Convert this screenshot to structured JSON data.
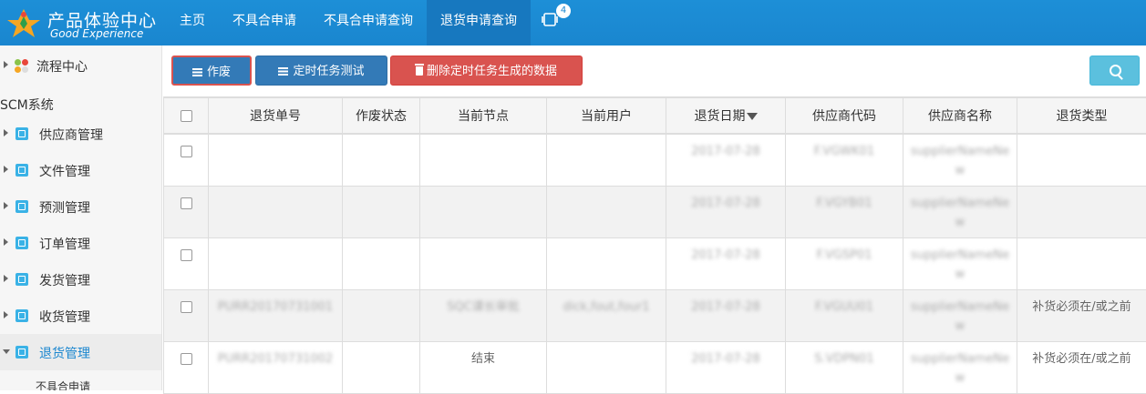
{
  "brand": {
    "title": "产品体验中心",
    "subtitle": "Good Experience"
  },
  "topnav": {
    "items": [
      {
        "label": "主页"
      },
      {
        "label": "不具合申请"
      },
      {
        "label": "不具合申请查询"
      },
      {
        "label": "退货申请查询",
        "active": true
      }
    ],
    "message_badge": "4"
  },
  "sidebar": {
    "flow_center": "流程中心",
    "section": "SCM系统",
    "items": [
      {
        "label": "供应商管理"
      },
      {
        "label": "文件管理"
      },
      {
        "label": "预测管理"
      },
      {
        "label": "订单管理"
      },
      {
        "label": "发货管理"
      },
      {
        "label": "收货管理"
      },
      {
        "label": "退货管理",
        "active": true
      }
    ],
    "sub_item": "不具合申请"
  },
  "toolbar": {
    "void_label": "作废",
    "task_test_label": "定时任务测试",
    "delete_label": "删除定时任务生成的数据"
  },
  "table": {
    "headers": [
      "退货单号",
      "作废状态",
      "当前节点",
      "当前用户",
      "退货日期",
      "供应商代码",
      "供应商名称",
      "退货类型"
    ],
    "rows": [
      {
        "order_no": "",
        "void_status": "",
        "node": "",
        "user": "",
        "date": "2017-07-28",
        "supplier_code": "F.VGWK01",
        "supplier_name": "supplierNameNew",
        "type": ""
      },
      {
        "order_no": "",
        "void_status": "",
        "node": "",
        "user": "",
        "date": "2017-07-28",
        "supplier_code": "F.VGYB01",
        "supplier_name": "supplierNameNew",
        "type": ""
      },
      {
        "order_no": "",
        "void_status": "",
        "node": "",
        "user": "",
        "date": "2017-07-28",
        "supplier_code": "F.VGSP01",
        "supplier_name": "supplierNameNew",
        "type": ""
      },
      {
        "order_no": "PURR20170731001",
        "void_status": "",
        "node": "SQC课长审批",
        "user": "dick,fout,four1",
        "date": "2017-07-28",
        "supplier_code": "F.VGUU01",
        "supplier_name": "supplierNameNew",
        "type": "补货必须在/或之前"
      },
      {
        "order_no": "PURR20170731002",
        "void_status": "",
        "node": "结束",
        "user": "",
        "date": "2017-07-28",
        "supplier_code": "S.VDPN01",
        "supplier_name": "supplierNameNew",
        "type": "补货必须在/或之前"
      }
    ]
  },
  "colors": {
    "topbar": "#1a86cf",
    "primary": "#337ab7",
    "danger": "#d9534f",
    "info": "#5bc0de"
  }
}
